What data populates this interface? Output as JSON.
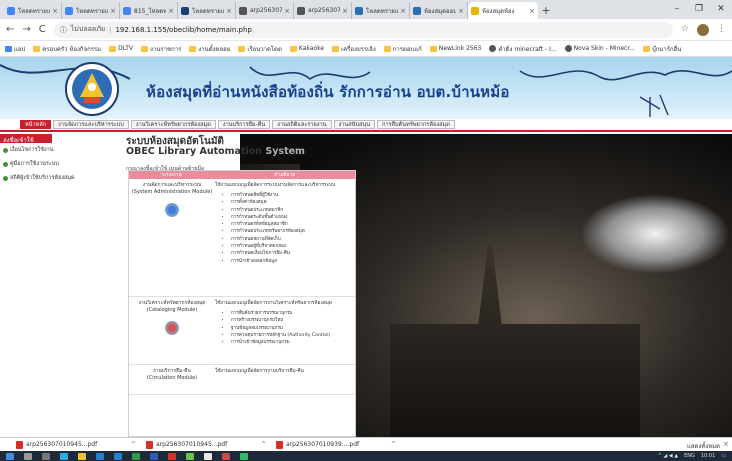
{
  "browser": {
    "tabs": [
      {
        "title": "โหลดทรายแหลม",
        "color": "#4285f4"
      },
      {
        "title": "โหลดทรายแหลม",
        "color": "#4285f4"
      },
      {
        "title": "815_โหลดทรา",
        "color": "#4285f4"
      },
      {
        "title": "โหลดทรายแหลม",
        "color": "#1a3e7a"
      },
      {
        "title": "arp2563070",
        "color": "#555555"
      },
      {
        "title": "arp2563070",
        "color": "#555555"
      },
      {
        "title": "โหลดทรายแห",
        "color": "#2a6fb0"
      },
      {
        "title": "ห้องสมุดออน",
        "color": "#2a6fb0"
      },
      {
        "title": "ห้องสมุดห้อง",
        "color": "#e8b400"
      }
    ],
    "new_tab": "+",
    "address": {
      "back": "←",
      "forward": "→",
      "reload": "C",
      "security": "ไม่ปลอดภัย",
      "url": "192.168.1.155/obeclib/home/main.php"
    },
    "bookmarks": [
      {
        "label": "แอป",
        "kind": "apps"
      },
      {
        "label": "ครอบครัว ห้องกิจกรรม",
        "kind": "folder"
      },
      {
        "label": "DLTV",
        "kind": "folder"
      },
      {
        "label": "งานราชการ",
        "kind": "folder"
      },
      {
        "label": "งานตั้งหลอย",
        "kind": "folder"
      },
      {
        "label": "เรียนวาดโดด",
        "kind": "folder"
      },
      {
        "label": "Kakaoke",
        "kind": "folder"
      },
      {
        "label": "เครื่องบรรเลิง",
        "kind": "folder"
      },
      {
        "label": "การตอบแก้",
        "kind": "folder"
      },
      {
        "label": "NewLink 2563",
        "kind": "folder"
      },
      {
        "label": "ดำดิ่ง minecraft - I...",
        "kind": "globe"
      },
      {
        "label": "Nova Skin - Minecr...",
        "kind": "globe"
      },
      {
        "label": "บุ๊กมาร์กอื่น",
        "kind": "folder"
      }
    ]
  },
  "site": {
    "banner_title": "ห้องสมุดที่อ่านหนังสือท้องถิ่น รักการอ่าน อบต.บ้านหม้อ",
    "menu": [
      "หน้าหลัก",
      "งานจัดการและบริหารระบบ",
      "งานวิเคราะห์ทรัพยากรห้องสมุด",
      "งานบริการยืม-คืน",
      "งานสถิติและรายงาน",
      "งานสนับสนุน",
      "การสืบค้นทรัพยากรห้องสมุด"
    ],
    "left_panel": {
      "header": "ลงชื่อเข้าใช้",
      "items": [
        "เงื่อนไขการใช้งาน",
        "คู่มือการใช้งานระบบ",
        "สถิติผู้เข้าใช้บริการห้องสมุด"
      ]
    },
    "main": {
      "title": "ระบบห้องสมุดอัตโนมัติ",
      "subtitle": "OBEC Library Automation",
      "subtitle_suffix": "System",
      "note": "กรุณาลงชื่อเข้าใช้ เมนูด้านซ้ายมือ"
    },
    "module_table": {
      "headers": [
        "ระบบงาน",
        "คำอธิบาย"
      ],
      "rows": [
        {
          "name": "งานจัดการและบริหารระบบ",
          "module": "(System Administration Module)",
          "desc": "ใช้งานแยกเมนูเพื่อจัดการระบบงานจัดการและบริหารระบบ",
          "items": [
            "การกำหนดสิทธิ์ผู้ใช้งาน",
            "การตั้งค่าห้องสมุด",
            "การกำหนดประเภทสมาชิก",
            "การกำหนดระดับชั้นตำแหน่ง",
            "การกำหนดรหัสข้อมูลสมาชิก",
            "การกำหนดประเภททรัพยากรห้องสมุด",
            "การกำหนดสถานที่จัดเก็บ",
            "การกำหนดผู้ที่บริจาคยกย่อง",
            "การกำหนดเงื่อนไขการยืม-คืน",
            "การนำเข้าส่งออกข้อมูล"
          ]
        },
        {
          "name": "งานวิเคราะห์ทรัพยากรห้องสมุด",
          "module": "(Cataloging Module)",
          "desc": "ใช้งานแยกเมนูเพื่อจัดการงานวิเคราะห์ทรัพยากรห้องสมุด",
          "items": [
            "การสืบค้นรายการบรรณานุกรม",
            "การสร้างบรรณานุกรมใหม่",
            "ฐานข้อมูลสมบรรณานุกรม",
            "การควบคุมรายการหลักฐาน (Authority Control)",
            "การนำเข้าข้อมูลบรรณานุกรม"
          ]
        },
        {
          "name": "งานบริการยืม-คืน",
          "module": "(Circulation Module)",
          "desc": "ใช้งานแยกเมนูเพื่อจัดการงานบริการยืม-คืน",
          "items": []
        }
      ]
    }
  },
  "downloads": {
    "files": [
      "arp256307010945...pdf",
      "arp256307010945...pdf",
      "arp256307010939....pdf"
    ],
    "show_all": "แสดงทั้งหมด",
    "close": "×"
  },
  "taskbar": {
    "lang": "ENG",
    "time": "10:01"
  },
  "colors": {
    "accent_red": "#c8202f",
    "table_header": "#e88d99",
    "title_blue": "#17428f"
  }
}
